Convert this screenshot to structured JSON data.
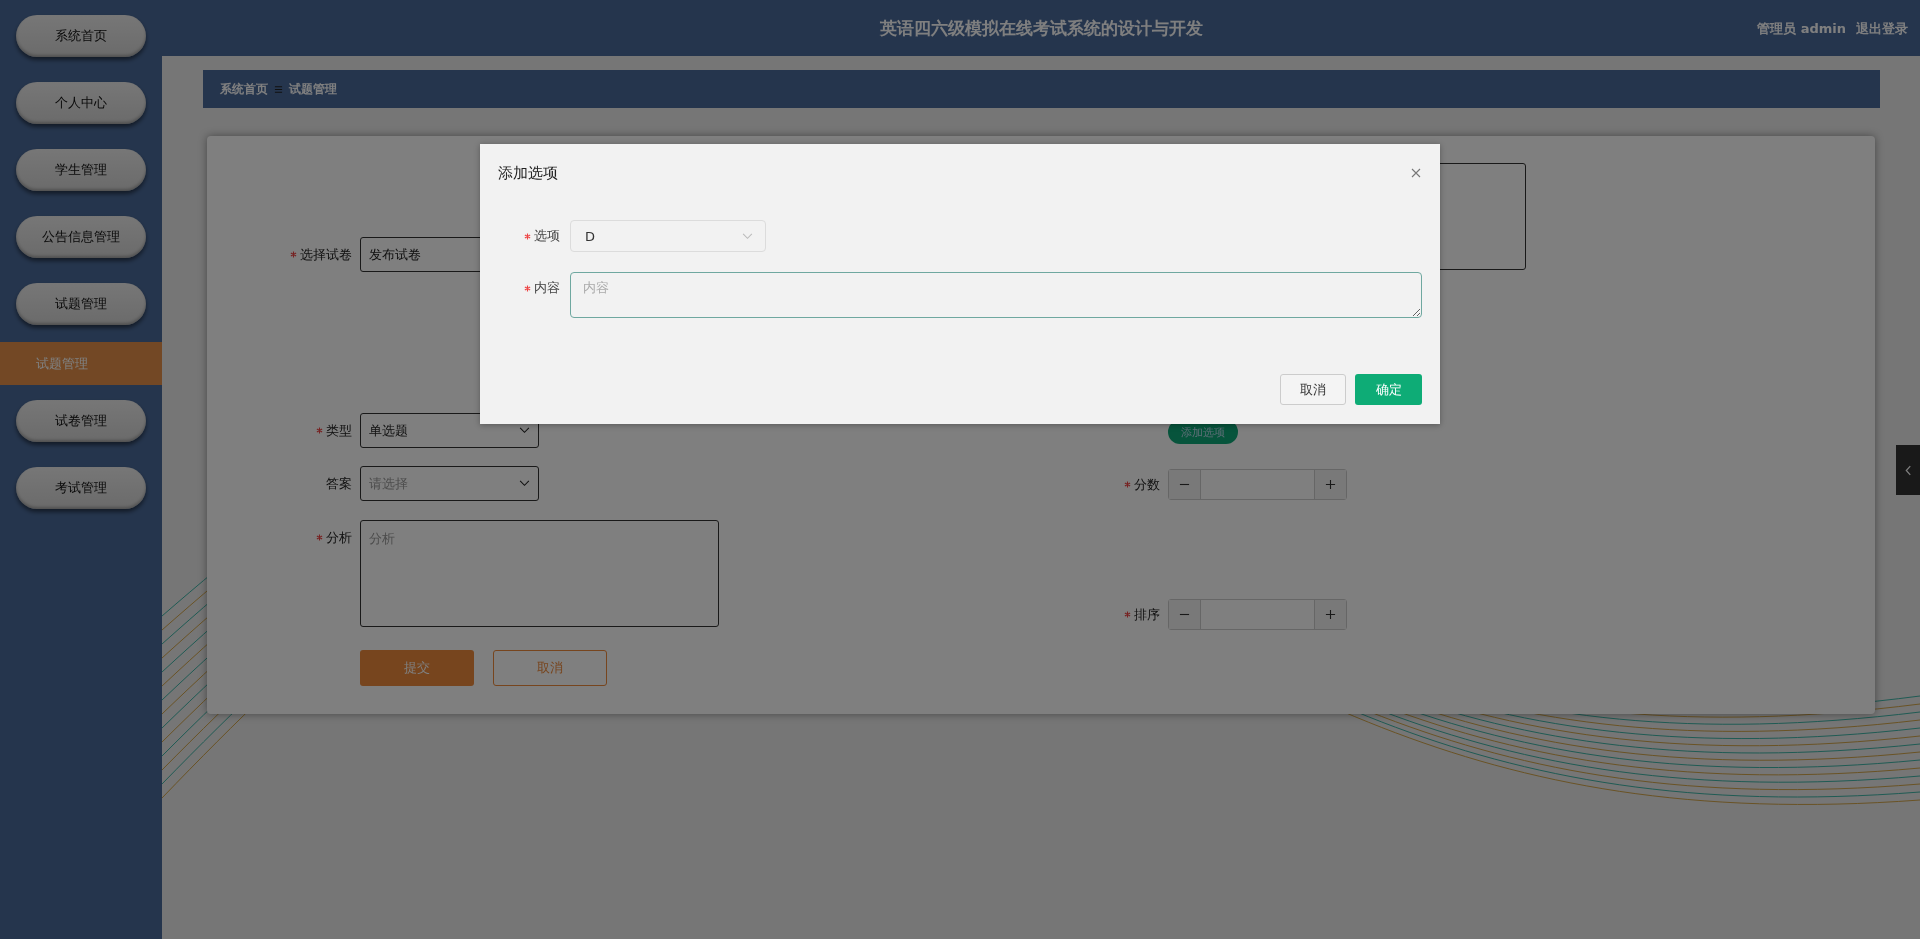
{
  "header": {
    "title": "英语四六级模拟在线考试系统的设计与开发",
    "user_role": "管理员",
    "user_name": "admin",
    "logout": "退出登录"
  },
  "sidebar": {
    "items": [
      {
        "label": "系统首页",
        "selected": false
      },
      {
        "label": "个人中心",
        "selected": false
      },
      {
        "label": "学生管理",
        "selected": false
      },
      {
        "label": "公告信息管理",
        "selected": false
      },
      {
        "label": "试题管理",
        "selected": false,
        "children": [
          {
            "label": "试题管理",
            "selected": true
          }
        ]
      },
      {
        "label": "试卷管理",
        "selected": false
      },
      {
        "label": "考试管理",
        "selected": false
      }
    ]
  },
  "breadcrumb": [
    "系统首页",
    "试题管理"
  ],
  "form": {
    "left_fields": [
      {
        "kind": "input",
        "label": "选择试卷",
        "required": true,
        "value": "发布试卷"
      },
      {
        "kind": "select",
        "label": "类型",
        "required": true,
        "value": "单选题"
      },
      {
        "kind": "select",
        "label": "答案",
        "required": false,
        "placeholder": "请选择"
      },
      {
        "kind": "textarea",
        "label": "分析",
        "required": true,
        "placeholder": "分析"
      }
    ],
    "right_fields": [
      {
        "kind": "textarea"
      },
      {
        "kind": "button",
        "label": "添加选项"
      },
      {
        "kind": "number",
        "label": "分数",
        "required": true
      },
      {
        "kind": "number",
        "label": "排序",
        "required": true
      }
    ],
    "buttons": [
      {
        "label": "提交",
        "kind": "primary"
      },
      {
        "label": "取消",
        "kind": "outline"
      }
    ]
  },
  "dialog": {
    "title": "添加选项",
    "fields": [
      {
        "kind": "select",
        "label": "选项",
        "required": true,
        "value": "D",
        "focused": false
      },
      {
        "kind": "textarea",
        "label": "内容",
        "required": true,
        "placeholder": "内容",
        "focused": true
      }
    ],
    "buttons": [
      {
        "label": "取消",
        "kind": "default"
      },
      {
        "label": "确定",
        "kind": "primary"
      }
    ]
  }
}
